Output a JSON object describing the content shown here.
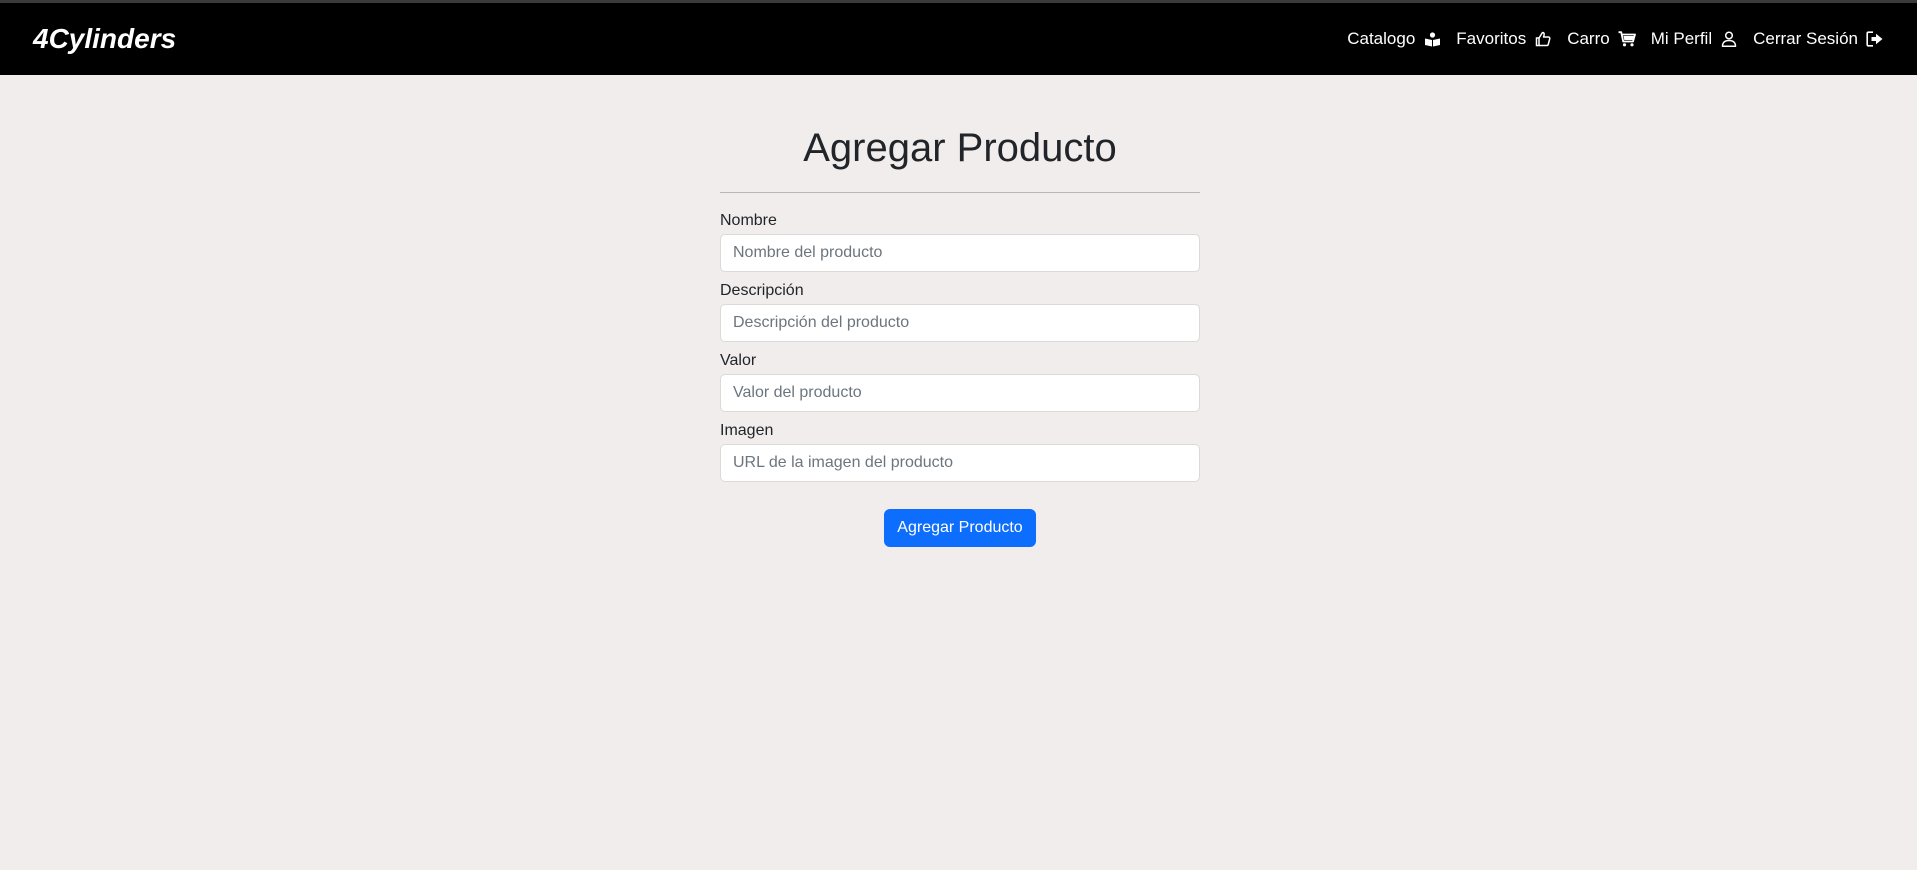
{
  "navbar": {
    "brand": "4Cylinders",
    "links": [
      {
        "label": "Catalogo",
        "icon": "book-reader-icon"
      },
      {
        "label": "Favoritos",
        "icon": "thumbs-up-icon"
      },
      {
        "label": "Carro",
        "icon": "cart-icon"
      },
      {
        "label": "Mi Perfil",
        "icon": "user-icon"
      },
      {
        "label": "Cerrar Sesión",
        "icon": "sign-out-icon"
      }
    ]
  },
  "form": {
    "title": "Agregar Producto",
    "fields": [
      {
        "label": "Nombre",
        "placeholder": "Nombre del producto",
        "value": ""
      },
      {
        "label": "Descripción",
        "placeholder": "Descripción del producto",
        "value": ""
      },
      {
        "label": "Valor",
        "placeholder": "Valor del producto",
        "value": ""
      },
      {
        "label": "Imagen",
        "placeholder": "URL de la imagen del producto",
        "value": ""
      }
    ],
    "submit_label": "Agregar Producto"
  },
  "colors": {
    "navbar_bg": "#000000",
    "page_bg": "#f1eded",
    "primary": "#0d6efd"
  }
}
